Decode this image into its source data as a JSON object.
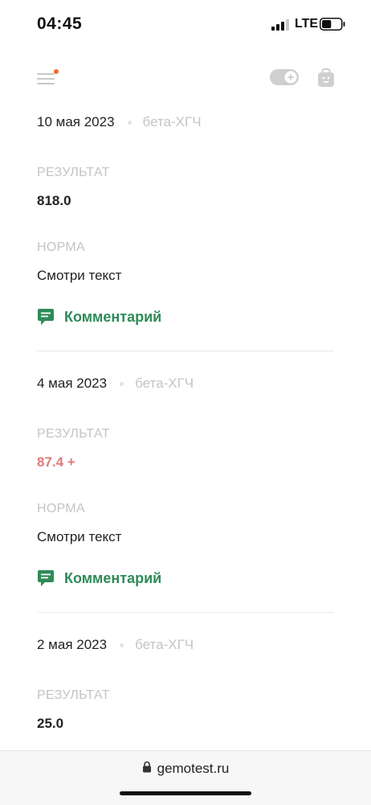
{
  "status_bar": {
    "time": "04:45",
    "network": "LTE",
    "battery_level": 0.5
  },
  "toolbar": {
    "notification_dot_color": "#f26b2a"
  },
  "section_labels": {
    "result": "РЕЗУЛЬТАТ",
    "norm": "НОРМА",
    "comment": "Комментарий"
  },
  "entries": [
    {
      "date": "10 мая 2023",
      "analyte": "бета-ХГЧ",
      "result": "818.0",
      "norm": "Смотри текст"
    },
    {
      "date": "4 мая 2023",
      "analyte": "бета-ХГЧ",
      "result": "87.4 +",
      "result_status": "abnormal",
      "norm": "Смотри текст"
    },
    {
      "date": "2 мая 2023",
      "analyte": "бета-ХГЧ",
      "result": "25.0"
    }
  ],
  "browser": {
    "url": "gemotest.ru"
  },
  "colors": {
    "accent_green": "#2e8b57",
    "abnormal_red": "#e07a7a",
    "muted_gray": "#c4c4c4"
  }
}
